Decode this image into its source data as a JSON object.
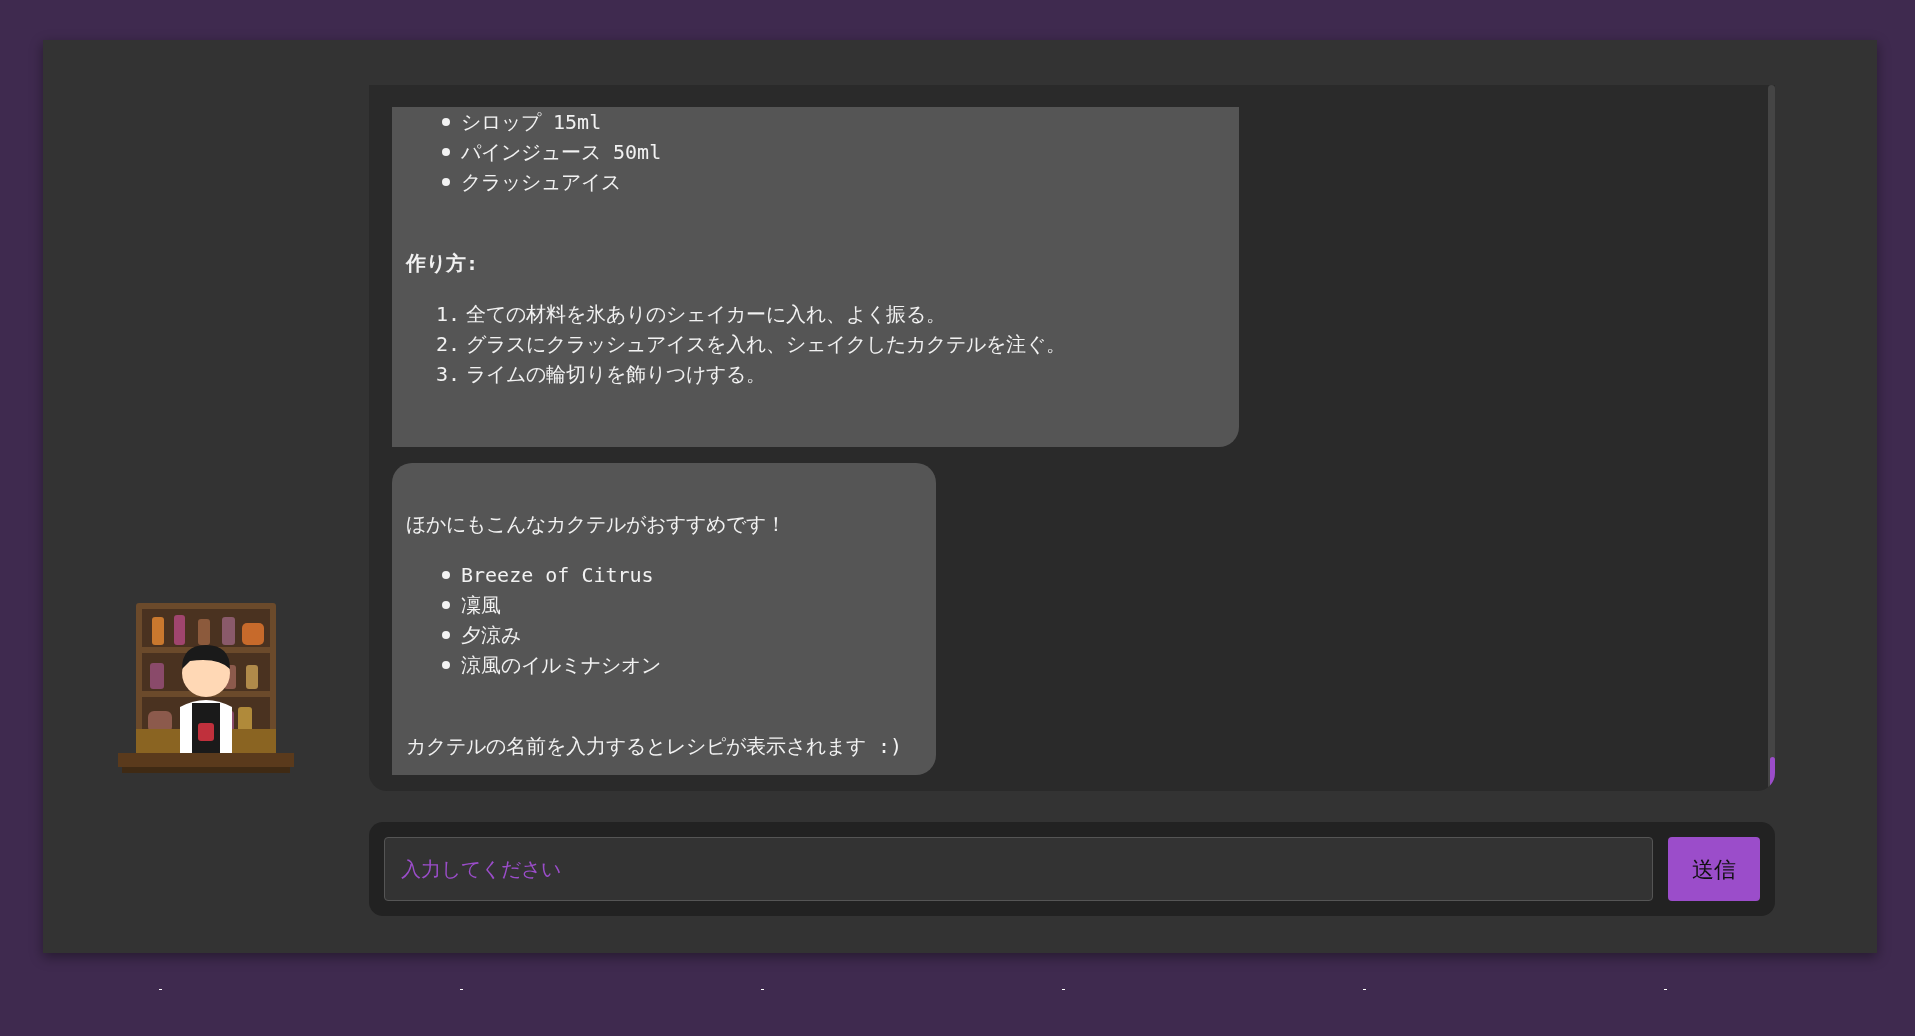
{
  "messages": [
    {
      "kind": "recipe",
      "ingredients": [
        "シロップ 15ml",
        "パインジュース 50ml",
        "クラッシュアイス"
      ],
      "method_heading": "作り方:",
      "steps": [
        {
          "number": "1.",
          "text": "全ての材料を氷ありのシェイカーに入れ、よく振る。"
        },
        {
          "number": "2.",
          "text": "グラスにクラッシュアイスを入れ、シェイクしたカクテルを注ぐ。"
        },
        {
          "number": "3.",
          "text": "ライムの輪切りを飾りつけする。"
        }
      ]
    },
    {
      "kind": "suggestions",
      "intro": "ほかにもこんなカクテルがおすすめです！",
      "items": [
        "Breeze of Citrus",
        "凜風",
        "夕涼み",
        "涼風のイルミナシオン"
      ],
      "footer": "カクテルの名前を入力するとレシピが表示されます :)"
    }
  ],
  "input": {
    "placeholder": "入力してください"
  },
  "send_button": {
    "label": "送信"
  }
}
